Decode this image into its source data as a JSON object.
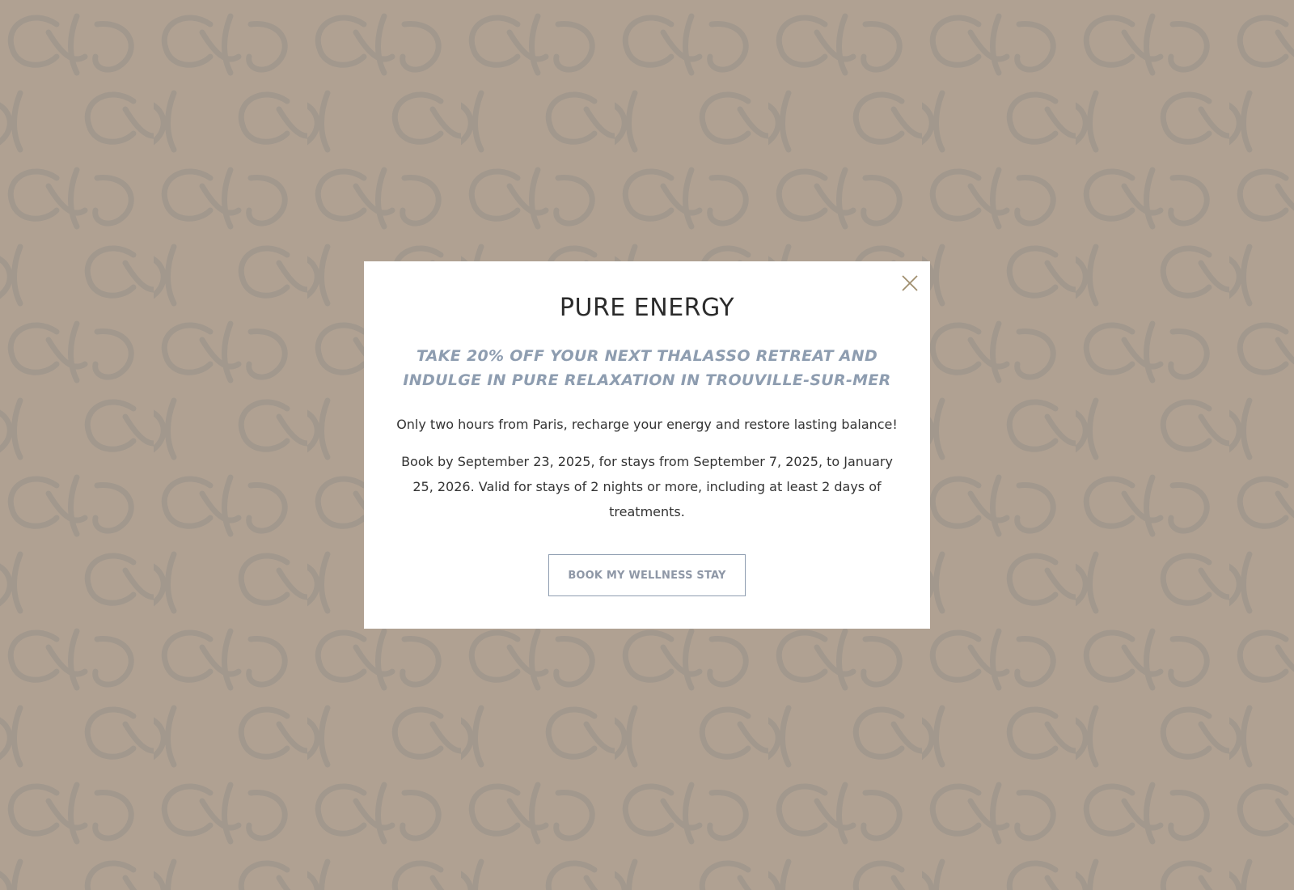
{
  "backdrop": {
    "color": "#b0a192",
    "pattern_color": "#a2988d",
    "pattern_icon": "monogram-pattern-icon"
  },
  "modal": {
    "title": "PURE ENERGY",
    "subtitle": "TAKE 20% OFF YOUR NEXT THALASSO RETREAT AND INDULGE IN PURE RELAXATION IN TROUVILLE-SUR-MER",
    "lead": "Only two hours from Paris, recharge your energy and restore lasting balance!",
    "terms": "Book by September 23, 2025, for stays from September 7, 2025, to January 25, 2026. Valid for stays of 2 nights or more, including at least 2 days of treatments.",
    "cta_label": "BOOK MY WELLNESS STAY",
    "close_icon": "close-icon",
    "colors": {
      "title": "#2b2b2b",
      "subtitle": "#8e9db0",
      "body": "#333333",
      "close": "#a08e6e",
      "cta_border": "#8e9db0",
      "cta_text": "#8e97a6"
    }
  }
}
